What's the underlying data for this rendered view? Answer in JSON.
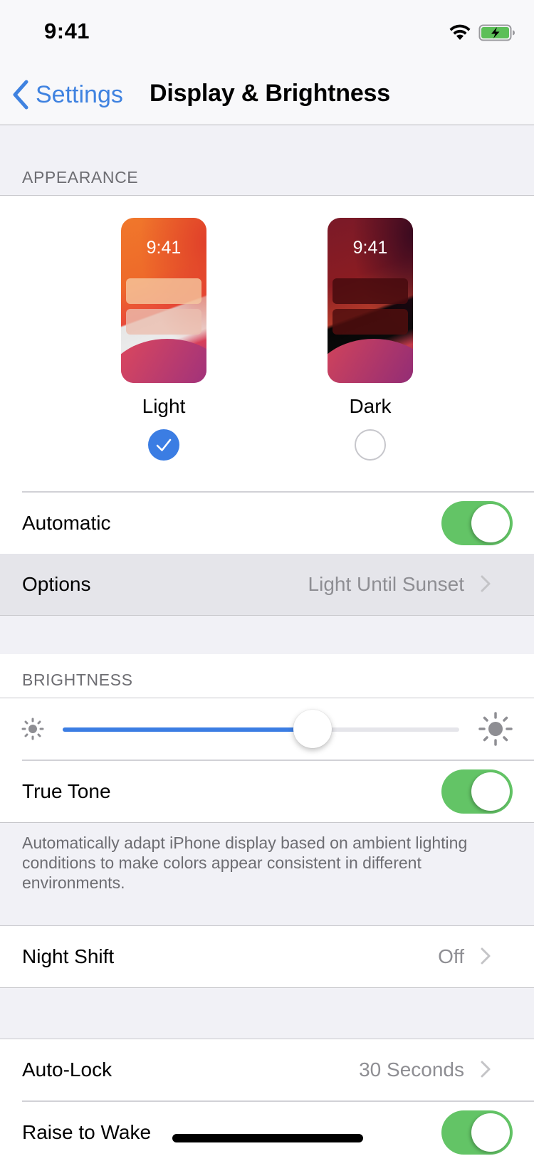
{
  "status_bar": {
    "time": "9:41",
    "wifi_icon": "wifi-icon",
    "battery_icon": "battery-charging-icon",
    "battery_color": "#5cbf58"
  },
  "nav": {
    "back_label": "Settings",
    "title": "Display & Brightness",
    "accent": "#3f82e0"
  },
  "appearance": {
    "header": "APPEARANCE",
    "options": [
      {
        "label": "Light",
        "preview_time": "9:41",
        "selected": true
      },
      {
        "label": "Dark",
        "preview_time": "9:41",
        "selected": false
      }
    ],
    "automatic": {
      "label": "Automatic",
      "on": true
    },
    "options_row": {
      "label": "Options",
      "value": "Light Until Sunset"
    }
  },
  "brightness": {
    "header": "BRIGHTNESS",
    "level": 0.63,
    "min_icon": "sun-small-icon",
    "max_icon": "sun-large-icon",
    "true_tone": {
      "label": "True Tone",
      "on": true
    },
    "footer": "Automatically adapt iPhone display based on ambient lighting conditions to make colors appear consistent in different environments."
  },
  "night_shift": {
    "label": "Night Shift",
    "value": "Off"
  },
  "auto_lock": {
    "label": "Auto-Lock",
    "value": "30 Seconds"
  },
  "raise_to_wake": {
    "label": "Raise to Wake",
    "on": true
  },
  "colors": {
    "switch_on": "#63c466",
    "selected_radio": "#3b7de3"
  }
}
